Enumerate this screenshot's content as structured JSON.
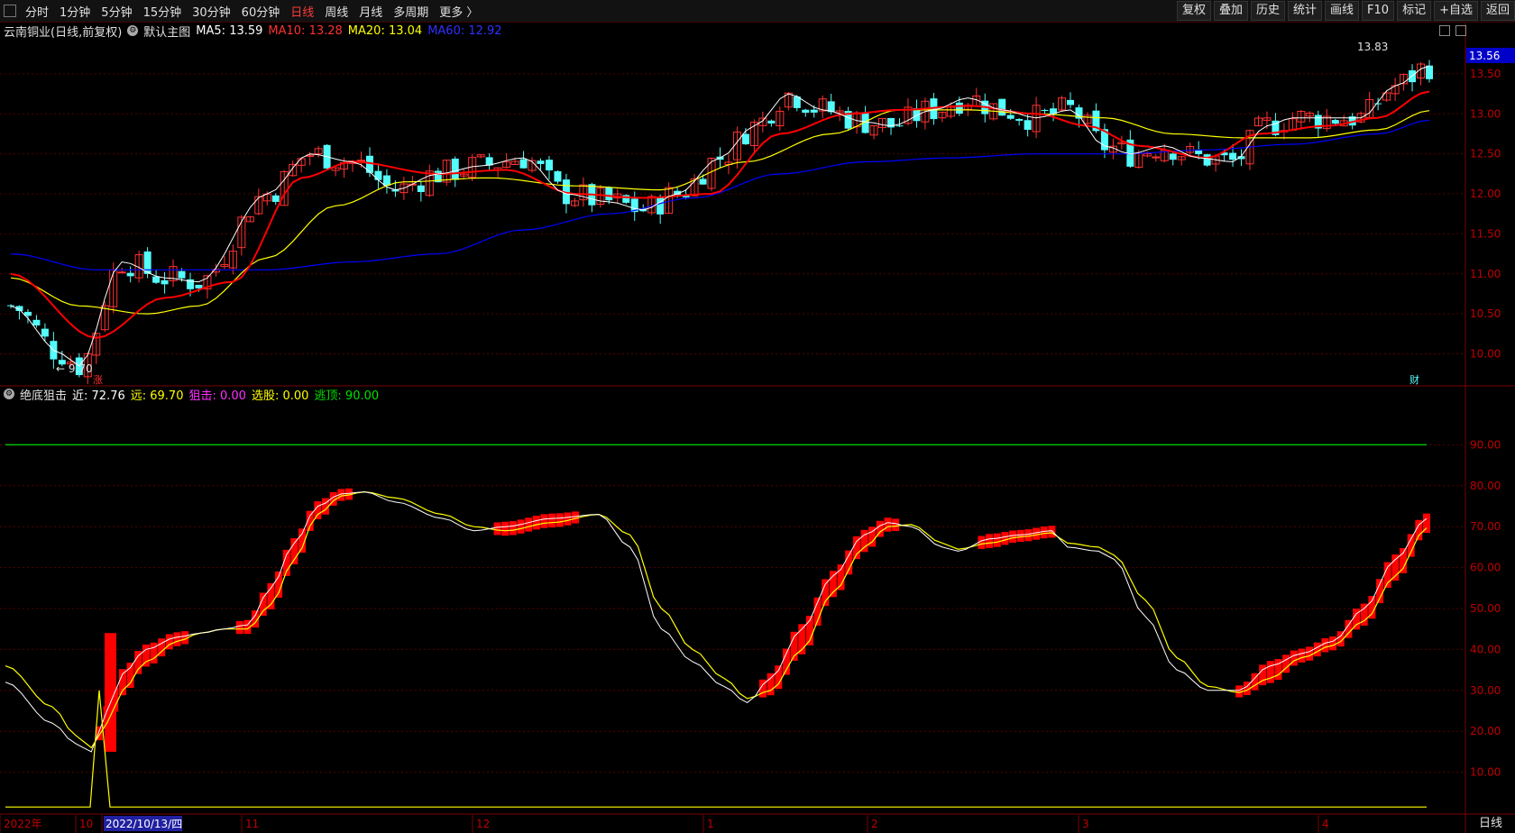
{
  "toolbar": {
    "tabs": [
      "分时",
      "1分钟",
      "5分钟",
      "15分钟",
      "30分钟",
      "60分钟",
      "日线",
      "周线",
      "月线",
      "多周期",
      "更多 〉"
    ],
    "active_index": 6,
    "right_tools": [
      "复权",
      "叠加",
      "历史",
      "统计",
      "画线",
      "F10",
      "标记",
      "+自选",
      "返回"
    ]
  },
  "stock": {
    "title": "云南铜业(日线,前复权)",
    "main_label": "默认主图",
    "ma5_label": "MA5: 13.59",
    "ma10_label": "MA10: 13.28",
    "ma20_label": "MA20: 13.04",
    "ma60_label": "MA60: 12.92",
    "high_label": "13.83",
    "low_label": "9.70",
    "last_price": "13.56",
    "rise_tag": "涨",
    "fin_tag": "财"
  },
  "indicator": {
    "name": "绝底狙击",
    "near": "近: 72.76",
    "far": "远: 69.70",
    "snipe": "狙击: 0.00",
    "select": "选股: 0.00",
    "escape": "逃顶: 90.00"
  },
  "x_axis": {
    "labels": [
      "2022年",
      "10",
      "2022/10/13/四",
      "11",
      "12",
      "1",
      "2",
      "3",
      "4"
    ]
  },
  "period_label": "日线",
  "colors": {
    "up": "#ff3232",
    "down": "#54fcfc",
    "ma5": "#ffffff",
    "ma10": "#ff0000",
    "ma20": "#ffff00",
    "ma60": "#0000ff",
    "grid": "#5a0000",
    "escape": "#00c000"
  },
  "chart_data": [
    {
      "type": "candlestick",
      "ylim": [
        9.6,
        13.95
      ],
      "y_ticks": [
        "13.50",
        "13.00",
        "12.50",
        "12.00",
        "11.50",
        "11.00",
        "10.50",
        "10.00"
      ],
      "ma5_anchors": [
        [
          0,
          10.6
        ],
        [
          6,
          10.0
        ],
        [
          8,
          9.85
        ],
        [
          13,
          11.15
        ],
        [
          18,
          10.95
        ],
        [
          22,
          10.9
        ],
        [
          30,
          12.0
        ],
        [
          35,
          12.5
        ],
        [
          40,
          12.4
        ],
        [
          45,
          12.05
        ],
        [
          50,
          12.25
        ],
        [
          55,
          12.35
        ],
        [
          60,
          12.45
        ],
        [
          65,
          12.0
        ],
        [
          70,
          11.9
        ],
        [
          74,
          11.8
        ],
        [
          78,
          12.0
        ],
        [
          83,
          12.45
        ],
        [
          87,
          12.85
        ],
        [
          91,
          13.25
        ],
        [
          95,
          13.05
        ],
        [
          100,
          12.9
        ],
        [
          103,
          12.85
        ],
        [
          108,
          13.05
        ],
        [
          112,
          13.2
        ],
        [
          116,
          13.05
        ],
        [
          120,
          12.95
        ],
        [
          124,
          13.05
        ],
        [
          128,
          12.6
        ],
        [
          131,
          12.5
        ],
        [
          135,
          12.6
        ],
        [
          139,
          12.45
        ],
        [
          143,
          12.4
        ],
        [
          147,
          12.85
        ],
        [
          150,
          12.95
        ],
        [
          155,
          12.95
        ],
        [
          158,
          12.95
        ],
        [
          162,
          13.35
        ],
        [
          166,
          13.6
        ]
      ],
      "ma10_anchors": [
        [
          0,
          11.0
        ],
        [
          10,
          10.2
        ],
        [
          18,
          10.7
        ],
        [
          26,
          10.9
        ],
        [
          34,
          12.2
        ],
        [
          40,
          12.4
        ],
        [
          50,
          12.25
        ],
        [
          58,
          12.3
        ],
        [
          66,
          12.0
        ],
        [
          74,
          11.95
        ],
        [
          82,
          12.0
        ],
        [
          90,
          12.75
        ],
        [
          98,
          13.0
        ],
        [
          104,
          13.05
        ],
        [
          112,
          13.1
        ],
        [
          120,
          13.0
        ],
        [
          126,
          12.85
        ],
        [
          132,
          12.6
        ],
        [
          140,
          12.45
        ],
        [
          146,
          12.75
        ],
        [
          154,
          12.85
        ],
        [
          160,
          12.95
        ],
        [
          166,
          13.28
        ]
      ],
      "ma20_anchors": [
        [
          0,
          10.95
        ],
        [
          8,
          10.6
        ],
        [
          16,
          10.5
        ],
        [
          22,
          10.6
        ],
        [
          30,
          11.2
        ],
        [
          38,
          11.85
        ],
        [
          46,
          12.15
        ],
        [
          56,
          12.2
        ],
        [
          66,
          12.1
        ],
        [
          76,
          12.05
        ],
        [
          86,
          12.4
        ],
        [
          96,
          12.75
        ],
        [
          104,
          13.05
        ],
        [
          112,
          13.05
        ],
        [
          120,
          13.0
        ],
        [
          128,
          12.95
        ],
        [
          136,
          12.75
        ],
        [
          144,
          12.7
        ],
        [
          152,
          12.7
        ],
        [
          160,
          12.8
        ],
        [
          166,
          13.04
        ]
      ],
      "ma60_anchors": [
        [
          0,
          11.25
        ],
        [
          10,
          11.05
        ],
        [
          20,
          11.05
        ],
        [
          30,
          11.05
        ],
        [
          40,
          11.15
        ],
        [
          50,
          11.25
        ],
        [
          60,
          11.55
        ],
        [
          70,
          11.75
        ],
        [
          80,
          11.95
        ],
        [
          90,
          12.25
        ],
        [
          100,
          12.4
        ],
        [
          110,
          12.45
        ],
        [
          120,
          12.5
        ],
        [
          130,
          12.5
        ],
        [
          140,
          12.55
        ],
        [
          150,
          12.62
        ],
        [
          160,
          12.75
        ],
        [
          166,
          12.92
        ]
      ],
      "candle_count": 167
    },
    {
      "type": "line",
      "ylim": [
        0,
        100
      ],
      "y_ticks": [
        "90.00",
        "80.00",
        "70.00",
        "60.00",
        "50.00",
        "40.00",
        "30.00",
        "20.00",
        "10.00"
      ],
      "escape_level": 90,
      "near_anchors": [
        [
          0,
          32
        ],
        [
          6,
          22
        ],
        [
          9,
          17
        ],
        [
          11,
          15
        ],
        [
          13,
          25
        ],
        [
          15,
          34
        ],
        [
          18,
          40
        ],
        [
          22,
          43
        ],
        [
          25,
          44
        ],
        [
          28,
          45
        ],
        [
          31,
          46
        ],
        [
          34,
          55
        ],
        [
          37,
          66
        ],
        [
          40,
          75
        ],
        [
          43,
          78
        ],
        [
          46,
          78.5
        ],
        [
          50,
          76
        ],
        [
          56,
          72
        ],
        [
          60,
          69
        ],
        [
          64,
          70
        ],
        [
          70,
          72
        ],
        [
          76,
          73
        ],
        [
          80,
          65
        ],
        [
          84,
          45
        ],
        [
          88,
          37
        ],
        [
          92,
          31
        ],
        [
          95,
          27
        ],
        [
          98,
          33
        ],
        [
          102,
          45
        ],
        [
          106,
          58
        ],
        [
          110,
          68
        ],
        [
          113,
          71
        ],
        [
          116,
          70
        ],
        [
          120,
          65
        ],
        [
          122,
          64
        ],
        [
          126,
          67
        ],
        [
          130,
          68
        ],
        [
          134,
          69
        ],
        [
          136,
          65
        ],
        [
          140,
          64
        ],
        [
          142,
          62
        ],
        [
          146,
          48
        ],
        [
          150,
          35
        ],
        [
          154,
          30
        ],
        [
          158,
          30
        ],
        [
          162,
          36
        ],
        [
          166,
          39
        ],
        [
          170,
          42
        ],
        [
          174,
          50
        ],
        [
          178,
          62
        ],
        [
          182,
          72
        ]
      ],
      "far_anchors": [
        [
          0,
          36
        ],
        [
          6,
          26
        ],
        [
          9,
          19
        ],
        [
          11,
          16
        ],
        [
          13,
          22
        ],
        [
          15,
          30
        ],
        [
          18,
          37
        ],
        [
          22,
          42
        ],
        [
          25,
          44
        ],
        [
          28,
          45
        ],
        [
          31,
          45
        ],
        [
          34,
          51
        ],
        [
          37,
          62
        ],
        [
          40,
          73
        ],
        [
          43,
          77.5
        ],
        [
          46,
          78.5
        ],
        [
          50,
          77
        ],
        [
          56,
          73
        ],
        [
          60,
          70
        ],
        [
          64,
          69
        ],
        [
          70,
          71
        ],
        [
          76,
          73
        ],
        [
          80,
          68
        ],
        [
          84,
          50
        ],
        [
          88,
          40
        ],
        [
          92,
          33
        ],
        [
          95,
          28
        ],
        [
          98,
          30
        ],
        [
          102,
          40
        ],
        [
          106,
          54
        ],
        [
          110,
          65
        ],
        [
          113,
          70
        ],
        [
          116,
          70.5
        ],
        [
          120,
          66
        ],
        [
          122,
          64.5
        ],
        [
          126,
          66
        ],
        [
          130,
          67.5
        ],
        [
          134,
          68.5
        ],
        [
          136,
          66
        ],
        [
          140,
          65
        ],
        [
          142,
          63
        ],
        [
          146,
          52
        ],
        [
          150,
          38
        ],
        [
          154,
          31
        ],
        [
          158,
          29.5
        ],
        [
          162,
          33
        ],
        [
          166,
          38
        ],
        [
          170,
          41
        ],
        [
          174,
          47
        ],
        [
          178,
          58
        ],
        [
          182,
          69.7
        ]
      ]
    }
  ]
}
